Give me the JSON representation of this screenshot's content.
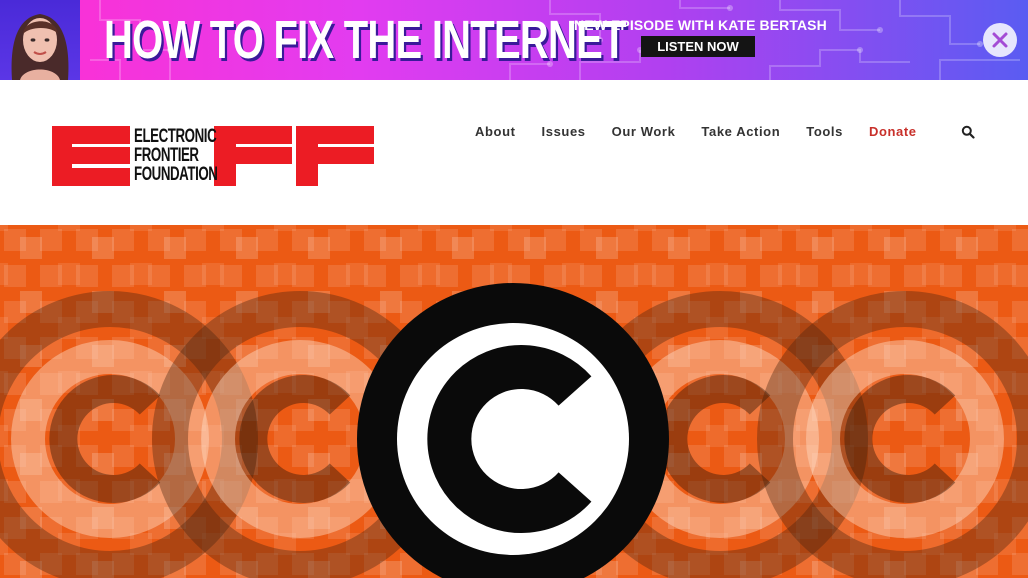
{
  "banner": {
    "headline": "HOW TO FIX THE INTERNET",
    "episode_text": "NEW EPISODE WITH KATE BERTASH",
    "listen_label": "LISTEN NOW",
    "close_icon": "close-icon",
    "colors": {
      "pink": "#ff2fd0",
      "purple": "#b040f0",
      "blue": "#5a5cf2"
    }
  },
  "header": {
    "logo": {
      "letters": "EFF",
      "line1": "ELECTRONIC",
      "line2": "FRONTIER",
      "line3": "FOUNDATION",
      "color": "#ec1c24"
    },
    "nav": [
      {
        "label": "About"
      },
      {
        "label": "Issues"
      },
      {
        "label": "Our Work"
      },
      {
        "label": "Take Action"
      },
      {
        "label": "Tools"
      },
      {
        "label": "Donate",
        "accent": "#c8302a"
      }
    ],
    "search_icon": "search-icon"
  },
  "hero": {
    "image": "copyright-symbol-graphic",
    "background": "#ec5a14"
  }
}
